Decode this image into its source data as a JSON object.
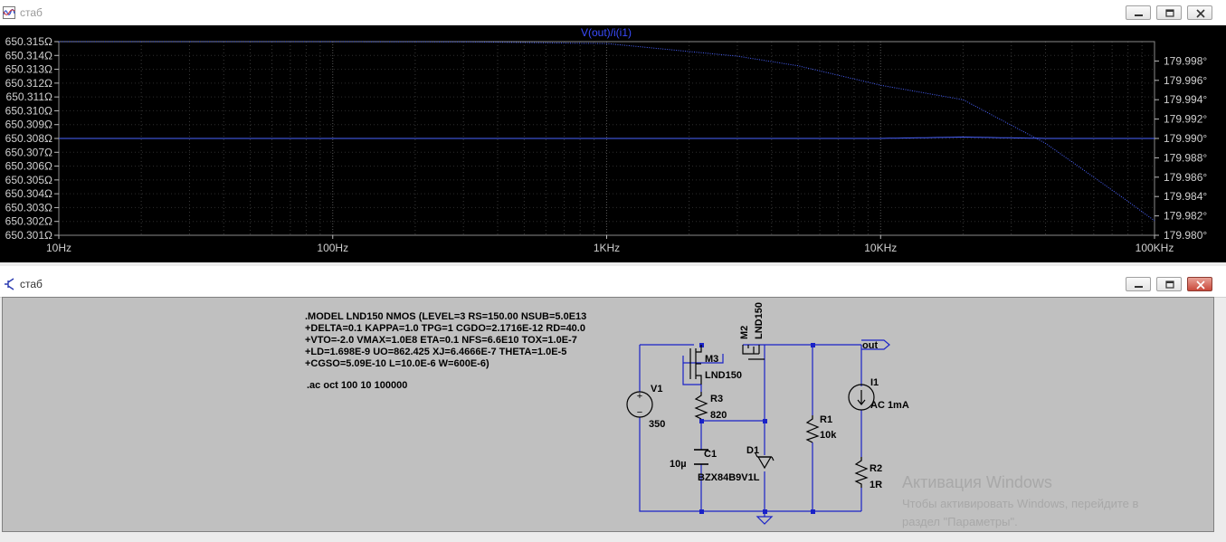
{
  "plot_window": {
    "title": "стаб",
    "trace_label": "V(out)/i(i1)",
    "chart_data": {
      "type": "line",
      "title": "V(out)/i(i1)",
      "x_scale": "log",
      "xlim": [
        10,
        100000
      ],
      "x_ticks": [
        "10Hz",
        "100Hz",
        "1KHz",
        "10KHz",
        "100KHz"
      ],
      "y_left_ticks": [
        "650.315Ω",
        "650.314Ω",
        "650.313Ω",
        "650.312Ω",
        "650.311Ω",
        "650.310Ω",
        "650.309Ω",
        "650.308Ω",
        "650.307Ω",
        "650.306Ω",
        "650.305Ω",
        "650.304Ω",
        "650.303Ω",
        "650.302Ω",
        "650.301Ω"
      ],
      "y_right_ticks": [
        "179.998°",
        "179.996°",
        "179.994°",
        "179.992°",
        "179.990°",
        "179.988°",
        "179.986°",
        "179.984°",
        "179.982°",
        "179.980°"
      ],
      "ylim_left": [
        650.301,
        650.315
      ],
      "ylim_right": [
        179.98,
        180.0
      ],
      "series": [
        {
          "axis": "left",
          "color": "#4a63ff",
          "style": "solid",
          "x": [
            10,
            100,
            1000,
            10000,
            20000,
            40000,
            100000
          ],
          "y": [
            650.308,
            650.308,
            650.308,
            650.308,
            650.3081,
            650.308,
            650.308
          ]
        },
        {
          "axis": "right",
          "color": "#4a63ff",
          "style": "dotted",
          "x": [
            10,
            100,
            300,
            1000,
            3000,
            5000,
            10000,
            20000,
            40000,
            60000,
            80000,
            100000
          ],
          "y": [
            180.0,
            180.0,
            179.99998,
            179.9998,
            179.9985,
            179.9975,
            179.9955,
            179.994,
            179.9895,
            179.986,
            179.9835,
            179.9815
          ]
        }
      ]
    }
  },
  "schematic_window": {
    "title": "стаб",
    "model_lines": [
      ".MODEL LND150 NMOS (LEVEL=3 RS=150.00 NSUB=5.0E13",
      "+DELTA=0.1 KAPPA=1.0 TPG=1 CGDO=2.1716E-12 RD=40.0",
      "+VTO=-2.0 VMAX=1.0E8 ETA=0.1 NFS=6.6E10 TOX=1.0E-7",
      "+LD=1.698E-9 UO=862.425 XJ=6.4666E-7 THETA=1.0E-5",
      "+CGSO=5.09E-10 L=10.0E-6 W=600E-6)"
    ],
    "ac_directive": ".ac oct 100 10 100000",
    "labels": {
      "m2_name": "M2",
      "m2_value": "LND150",
      "m3_name": "M3",
      "m3_value": "LND150",
      "r3_name": "R3",
      "r3_value": "820",
      "v1_name": "V1",
      "v1_value": "350",
      "c1_name": "C1",
      "c1_value": "10µ",
      "d1_name": "D1",
      "d1_value": "BZX84B9V1L",
      "r1_name": "R1",
      "r1_value": "10k",
      "i1_name": "I1",
      "i1_value": "AC 1mA",
      "r2_name": "R2",
      "r2_value": "1R",
      "out_label": "out"
    },
    "watermark": {
      "title": "Активация Windows",
      "line1": "Чтобы активировать Windows, перейдите в",
      "line2": "раздел \"Параметры\"."
    }
  },
  "colors": {
    "wire": "#1a22c8",
    "text_dark": "#000000",
    "trace": "#4a63ff",
    "axis_text": "#c8c8c8"
  }
}
